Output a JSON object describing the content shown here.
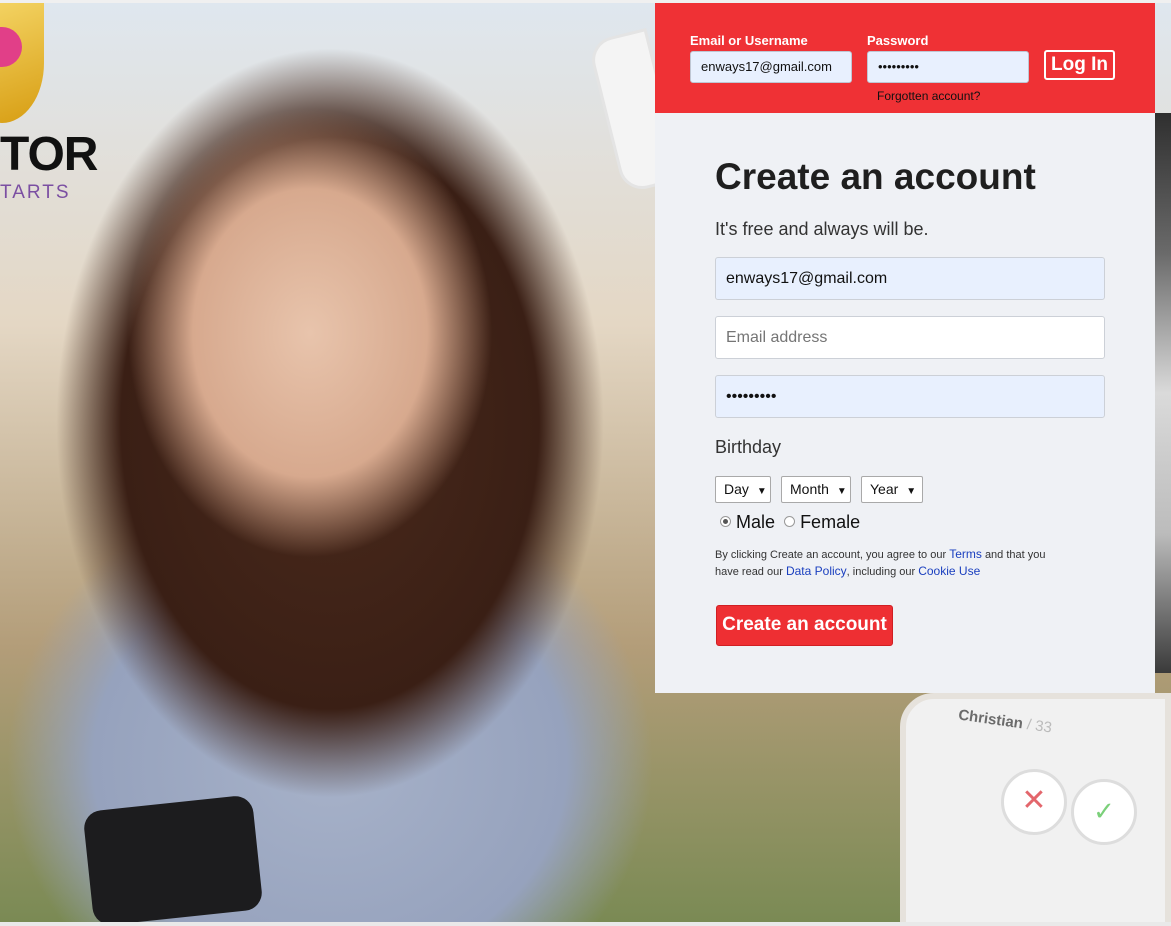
{
  "brand": {
    "logo_text": "TOR",
    "logo_subtext": "TARTS"
  },
  "login": {
    "email_label": "Email or Username",
    "email_value": "enways17@gmail.com",
    "password_label": "Password",
    "password_value": "•••••••••",
    "login_button": "Log In",
    "forgot_link": "Forgotten account?"
  },
  "signup": {
    "title": "Create an account",
    "subtitle": "It's free and always will be.",
    "field1_value": "enways17@gmail.com",
    "email_placeholder": "Email address",
    "password_value": "•••••••••",
    "birthday_label": "Birthday",
    "day_select": "Day",
    "month_select": "Month",
    "year_select": "Year",
    "gender_male": "Male",
    "gender_female": "Female",
    "selected_gender": "Male",
    "terms_part1": "By clicking Create an account, you agree to our",
    "terms_link": "Terms",
    "terms_part2": "and that you have read our",
    "data_policy_link": "Data Policy",
    "terms_part3": ", including our",
    "cookie_link": "Cookie Use",
    "create_button": "Create an account"
  },
  "hero": {
    "tinder_card_name": "Christian",
    "tinder_card_age": "/ 33"
  },
  "colors": {
    "accent_red": "#ef3135",
    "panel_bg": "#eff1f5",
    "link_blue": "#1a3fbf"
  }
}
